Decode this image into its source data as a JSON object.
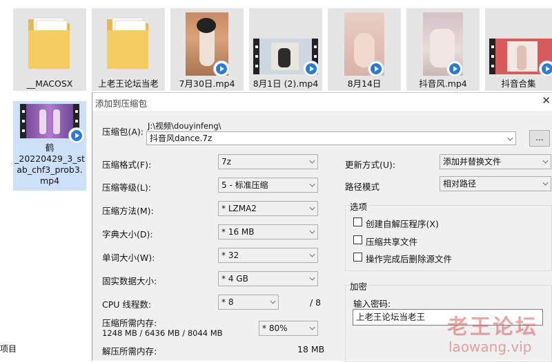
{
  "explorer": {
    "files": [
      {
        "label": "__MACOSX",
        "type": "folder"
      },
      {
        "label": "上老王论坛当老",
        "type": "folder"
      },
      {
        "label": "7月30日.mp4",
        "type": "video"
      },
      {
        "label": "8月1日 (2).mp4",
        "type": "video"
      },
      {
        "label": "8月14日",
        "type": "video"
      },
      {
        "label": "抖音风.mp4",
        "type": "video"
      },
      {
        "label": "抖音合集",
        "type": "video"
      }
    ],
    "selected_file": {
      "label_lines": [
        "鹤",
        "_20220429_3_st",
        "ab_chf3_prob3.",
        "mp4"
      ]
    },
    "footer_text": "项目"
  },
  "dialog": {
    "title": "添加到压缩包",
    "archive_label": "压缩包(A):",
    "archive_path": "J:\\视频\\douyinfeng\\",
    "archive_name": "抖音风dance.7z",
    "browse_label": "...",
    "left": {
      "format_label": "压缩格式(F):",
      "format_value": "7z",
      "level_label": "压缩等级(L):",
      "level_value": "5 - 标准压缩",
      "method_label": "压缩方法(M):",
      "method_value": "* LZMA2",
      "dict_label": "字典大小(D):",
      "dict_value": "* 16 MB",
      "word_label": "单词大小(W):",
      "word_value": "* 32",
      "solid_label": "固实数据大小:",
      "solid_value": "* 4 GB",
      "cpu_label": "CPU 线程数:",
      "cpu_value": "* 8",
      "cpu_max": "/ 8",
      "mem_label": "压缩所需内存:",
      "mem_detail": "1248 MB / 6436 MB / 8044 MB",
      "mem_value": "* 80%",
      "decomp_label": "解压所需内存:",
      "decomp_value": "18 MB"
    },
    "right": {
      "update_label": "更新方式(U):",
      "update_value": "添加并替换文件",
      "path_label": "路径模式",
      "path_value": "相对路径",
      "options_title": "选项",
      "opt1": "创建自解压程序(X)",
      "opt2": "压缩共享文件",
      "opt3": "操作完成后删除源文件",
      "encrypt_title": "加密",
      "password_label": "输入密码:",
      "password_value": "上老王论坛当老王"
    }
  },
  "watermark": {
    "line1": "老王论坛",
    "line2": "laowang.vip"
  }
}
